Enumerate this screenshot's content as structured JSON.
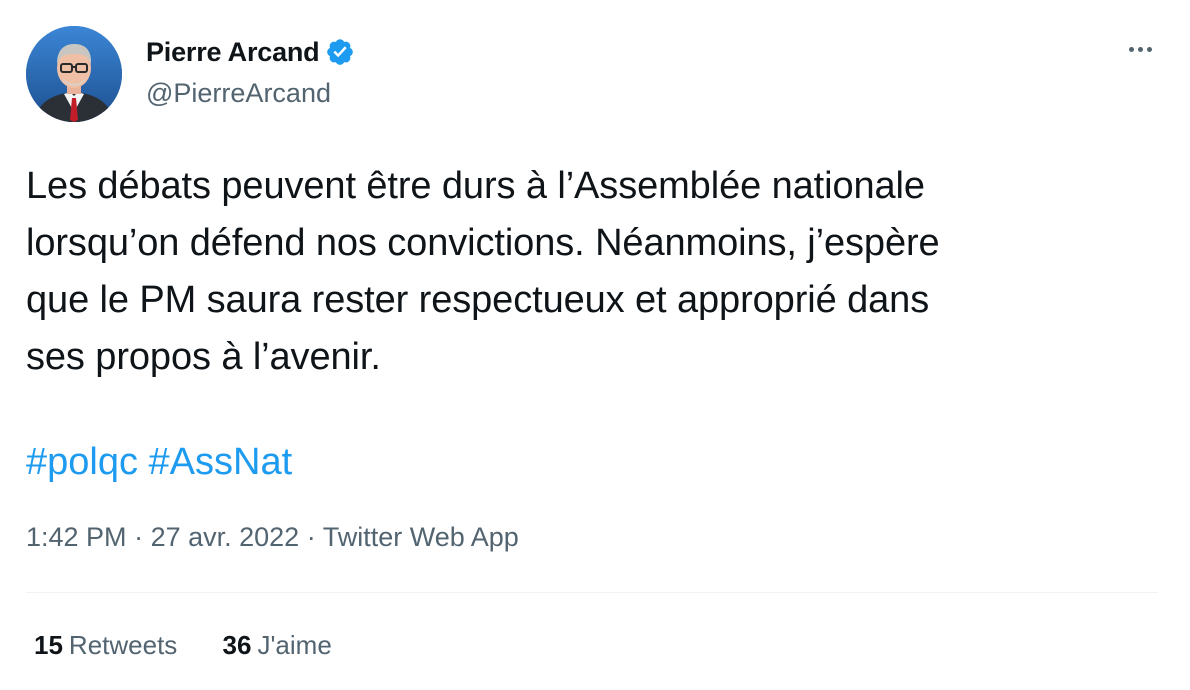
{
  "author": {
    "display_name": "Pierre Arcand",
    "handle": "@PierreArcand",
    "verified": true
  },
  "tweet": {
    "lines": [
      "Les débats peuvent être durs à l’Assemblée nationale",
      "lorsqu’on défend nos convictions. Néanmoins, j’espère",
      "que le PM saura rester respectueux et approprié dans",
      "ses propos à l’avenir."
    ],
    "hashtags": [
      "#polqc",
      "#AssNat"
    ]
  },
  "meta": {
    "time": "1:42 PM",
    "separator": " · ",
    "date": "27 avr. 2022",
    "source": "Twitter Web App"
  },
  "stats": {
    "retweets_count": "15",
    "retweets_label": "Retweets",
    "likes_count": "36",
    "likes_label": "J'aime"
  },
  "icons": {
    "verified": "verified-badge-icon",
    "more": "more-options-icon"
  },
  "colors": {
    "accent": "#1d9bf0",
    "text_primary": "#0f1419",
    "text_secondary": "#536471",
    "divider": "#eff3f4"
  }
}
